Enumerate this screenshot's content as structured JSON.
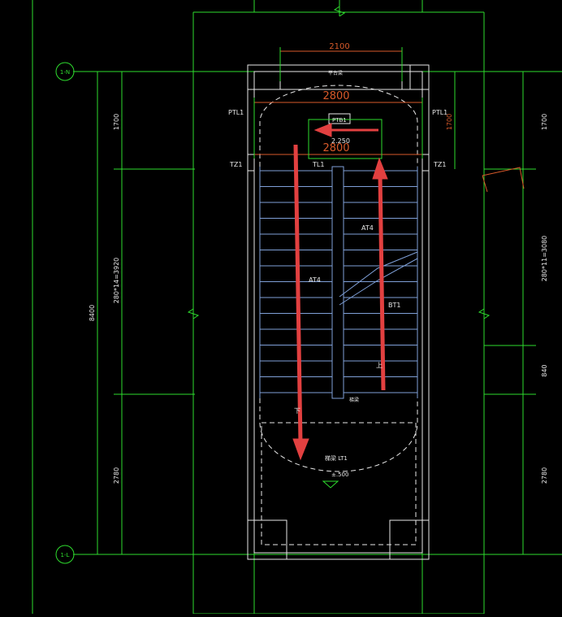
{
  "colors": {
    "background": "#000000",
    "grid": "#2edc2e",
    "wall": "#e8e8e8",
    "dimension": "#d85a2a",
    "dim_extension": "#2edc2e",
    "text": "#e8e8e8",
    "stair_tread": "#7fa0d8",
    "arrow": "#e24040",
    "dashed": "#e8e8e8"
  },
  "axes": {
    "top_axis": "1-N",
    "bottom_axis": "1-L"
  },
  "dims_top": {
    "width_2100": "2100",
    "width_2800": "2800",
    "width_2800_b": "2800"
  },
  "dims_left": {
    "total": "8400",
    "seg1": "1700",
    "seg2": "280*14=3920",
    "seg3": "2780"
  },
  "dims_right": {
    "seg1": "1700",
    "seg2": "280*11=3080",
    "seg3": "840",
    "seg4": "2780",
    "small": "1700"
  },
  "labels": {
    "ptl1_left": "PTL1",
    "ptl1_right": "PTL1",
    "tz1_left": "TZ1",
    "tz1_right": "TZ1",
    "ptb1": "PTB1",
    "elev_top": "2.250",
    "tl1": "TL1",
    "at4_right": "AT4",
    "at4_left": "AT4",
    "bt1": "BT1",
    "up": "上",
    "down": "下",
    "landing_beam": "梯梁",
    "landing_top": "平台梁",
    "lt1": "梯梁  LT1",
    "elev_bottom": "±.500"
  }
}
